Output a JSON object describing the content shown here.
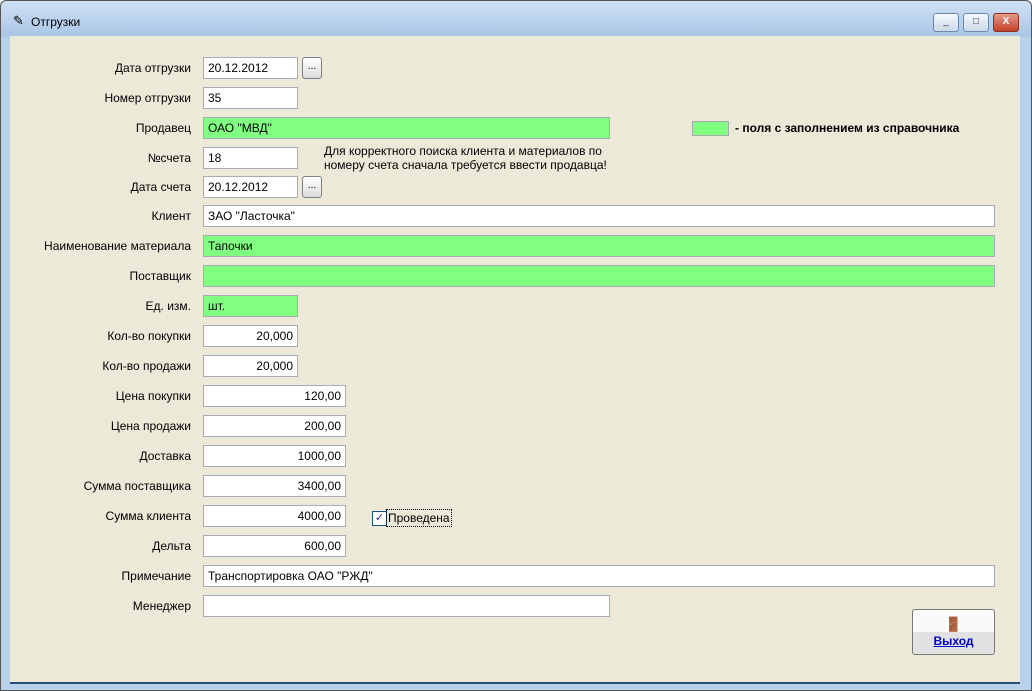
{
  "window": {
    "title": "Отгрузки",
    "minimize": "_",
    "maximize": "□",
    "close": "X"
  },
  "form": {
    "ship_date": {
      "label": "Дата отгрузки",
      "value": "20.12.2012"
    },
    "ship_number": {
      "label": "Номер отгрузки",
      "value": "35"
    },
    "seller": {
      "label": "Продавец",
      "value": "ОАО \"МВД\""
    },
    "invoice": {
      "label": "№счета",
      "value": "18"
    },
    "invoice_date": {
      "label": "Дата счета",
      "value": "20.12.2012"
    },
    "client": {
      "label": "Клиент",
      "value": "ЗАО \"Ласточка\""
    },
    "material": {
      "label": "Наименование материала",
      "value": "Тапочки"
    },
    "supplier": {
      "label": "Поставщик",
      "value": ""
    },
    "unit": {
      "label": "Ед. изм.",
      "value": "шт."
    },
    "qty_purchase": {
      "label": "Кол-во покупки",
      "value": "20,000"
    },
    "qty_sale": {
      "label": "Кол-во продажи",
      "value": "20,000"
    },
    "price_purchase": {
      "label": "Цена покупки",
      "value": "120,00"
    },
    "price_sale": {
      "label": "Цена продажи",
      "value": "200,00"
    },
    "delivery": {
      "label": "Доставка",
      "value": "1000,00"
    },
    "supplier_sum": {
      "label": "Сумма поставщика",
      "value": "3400,00"
    },
    "client_sum": {
      "label": "Сумма клиента",
      "value": "4000,00"
    },
    "delta": {
      "label": "Дельта",
      "value": "600,00"
    },
    "note": {
      "label": "Примечание",
      "value": "Транспортировка ОАО \"РЖД\""
    },
    "manager": {
      "label": "Менеджер",
      "value": ""
    },
    "dots": "...",
    "hint_line1": "Для корректного поиска клиента и материалов по",
    "hint_line2": "номеру счета сначала требуется ввести продавца!",
    "legend": "- поля с заполнением из справочника",
    "legend_color": "#80ff80",
    "posted": {
      "label": "Проведена",
      "checked": true,
      "mark": "✓"
    },
    "exit": "Выход"
  }
}
